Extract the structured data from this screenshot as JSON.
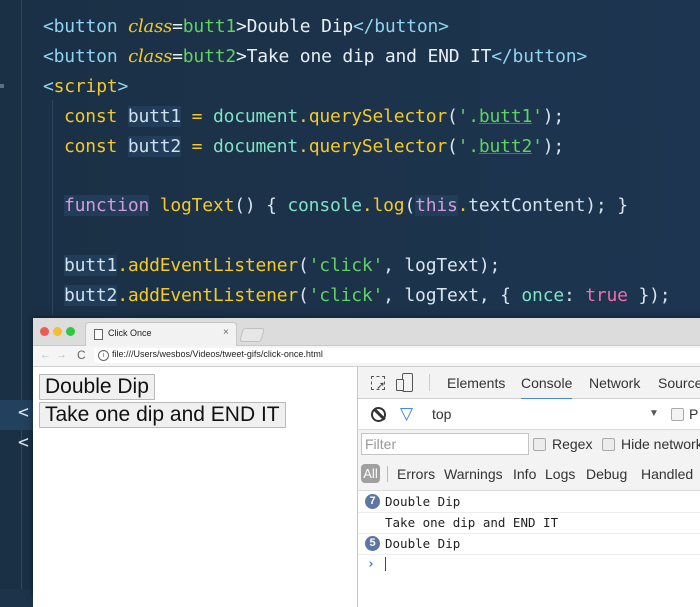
{
  "editor": {
    "line1": {
      "open": "<button ",
      "attr": "class",
      "eq": "=",
      "val": "butt1",
      "close": ">",
      "text": "Double Dip",
      "end": "</button>"
    },
    "line2": {
      "open": "<button ",
      "attr": "class",
      "eq": "=",
      "val": "butt2",
      "close": ">",
      "text": "Take one dip and END IT",
      "end": "</button>"
    },
    "line3": {
      "open": "<",
      "tag": "script",
      "close": ">"
    },
    "line4": {
      "kw": "const",
      "id": "butt1",
      "op": "=",
      "obj": "document",
      "dot": ".",
      "method": "querySelector",
      "p1": "(",
      "q1": "'.",
      "arg": "butt1",
      "q2": "'",
      "p2": ");"
    },
    "line5": {
      "kw": "const",
      "id": "butt2",
      "op": "=",
      "obj": "document",
      "dot": ".",
      "method": "querySelector",
      "p1": "(",
      "q1": "'.",
      "arg": "butt2",
      "q2": "'",
      "p2": ");"
    },
    "line6": {
      "kw": "function",
      "name": "logText",
      "rest1": "() { ",
      "obj": "console",
      "dot": ".",
      "method": "log",
      "p1": "(",
      "this": "this",
      "dot2": ".",
      "prop": "textContent",
      "rest2": "); }"
    },
    "line7": {
      "id": "butt1",
      "dot": ".",
      "method": "addEventListener",
      "p1": "(",
      "str": "'click'",
      "rest": ", logText);"
    },
    "line8": {
      "id": "butt2",
      "dot": ".",
      "method": "addEventListener",
      "p1": "(",
      "str": "'click'",
      "rest1": ", logText, { ",
      "prop": "once",
      "colon": ": ",
      "bool": "true",
      "rest2": " });"
    },
    "left_fragments": [
      "<",
      "<"
    ]
  },
  "browser": {
    "tab_title": "Click Once",
    "tab_close": "×",
    "url": "file:///Users/wesbos/Videos/tweet-gifs/click-once.html",
    "nav": {
      "back": "←",
      "forward": "→",
      "reload": "C",
      "info": "i"
    }
  },
  "page": {
    "buttons": [
      {
        "label": "Double Dip"
      },
      {
        "label": "Take one dip and END IT"
      }
    ]
  },
  "devtools": {
    "tabs": [
      {
        "label": "Elements",
        "active": false
      },
      {
        "label": "Console",
        "active": true
      },
      {
        "label": "Network",
        "active": false
      },
      {
        "label": "Sources",
        "active": false
      }
    ],
    "context": "top",
    "context_arrow": "▼",
    "preserve_label": "P",
    "filter_placeholder": "Filter",
    "regex_label": "Regex",
    "hide_network_label": "Hide network",
    "levels": [
      "All",
      "Errors",
      "Warnings",
      "Info",
      "Logs",
      "Debug",
      "Handled"
    ],
    "messages": [
      {
        "count": "7",
        "text": "Double Dip"
      },
      {
        "count": "",
        "text": "Take one dip and END IT"
      },
      {
        "count": "5",
        "text": "Double Dip"
      }
    ],
    "prompt": "›",
    "filter_glyph": "▽"
  }
}
